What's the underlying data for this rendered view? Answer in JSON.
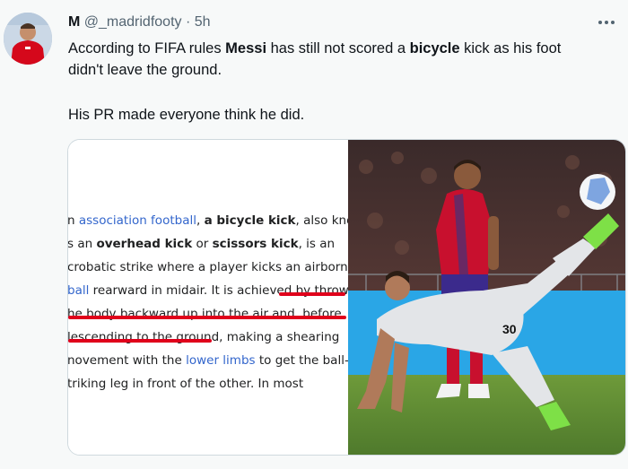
{
  "tweet": {
    "display_name": "M",
    "handle": "@_madridfooty",
    "separator": "·",
    "time": "5h",
    "more_icon": "more-dots-icon",
    "text_line1_parts": [
      "According to FIFA rules ",
      "Messi",
      " has still not scored a ",
      "bicycle",
      " kick as his foot"
    ],
    "text_line2": "didn't leave the ground.",
    "text_line3": "His PR made everyone think he did."
  },
  "wiki_excerpt": {
    "lines": [
      [
        {
          "t": "n "
        },
        {
          "t": "association football",
          "link": true
        },
        {
          "t": ", "
        },
        {
          "t": "a bicycle kick",
          "b": true
        },
        {
          "t": ", also knowr"
        }
      ],
      [
        {
          "t": "s an "
        },
        {
          "t": "overhead kick",
          "b": true
        },
        {
          "t": " or "
        },
        {
          "t": "scissors kick",
          "b": true
        },
        {
          "t": ", is an"
        }
      ],
      [
        {
          "t": "crobatic strike where a player kicks an airborne"
        }
      ],
      [
        {
          "t": "ball",
          "link": true
        },
        {
          "t": " rearward in midair. It is achieved by throwing"
        }
      ],
      [
        {
          "t": "he body backward up into the air and, before"
        }
      ],
      [
        {
          "t": "lescending to the ground, making a shearing"
        }
      ],
      [
        {
          "t": "novement with the "
        },
        {
          "t": "lower limbs",
          "link": true
        },
        {
          "t": " to get the ball-"
        }
      ],
      [
        {
          "t": "triking leg in front of the other. In most"
        }
      ]
    ]
  },
  "photo": {
    "description": "player-performing-bicycle-kick",
    "jersey_number": "30"
  },
  "colors": {
    "accent": "#1d9bf0",
    "link": "#3366cc",
    "underline": "#e0001b",
    "jersey_red": "#c8102e",
    "jersey_blue": "#1d3c8f"
  }
}
